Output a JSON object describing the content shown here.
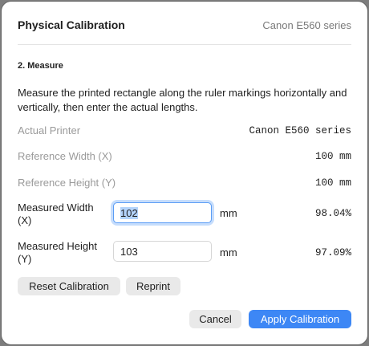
{
  "header": {
    "title": "Physical Calibration",
    "device": "Canon E560 series"
  },
  "section": {
    "title": "2. Measure",
    "instruction": "Measure the printed rectangle along the ruler markings horizontally and vertically, then enter the actual lengths."
  },
  "rows": {
    "printer_label": "Actual Printer",
    "printer_value": "Canon E560 series",
    "ref_width_label": "Reference Width (X)",
    "ref_width_value": "100 mm",
    "ref_height_label": "Reference Height (Y)",
    "ref_height_value": "100 mm",
    "meas_width_label_1": "Measured Width",
    "meas_width_label_2": "(X)",
    "meas_width_input": "102",
    "meas_width_unit": "mm",
    "meas_width_pct": "98.04%",
    "meas_height_label_1": "Measured Height",
    "meas_height_label_2": "(Y)",
    "meas_height_input": "103",
    "meas_height_unit": "mm",
    "meas_height_pct": "97.09%"
  },
  "buttons": {
    "reset": "Reset Calibration",
    "reprint": "Reprint",
    "cancel": "Cancel",
    "apply": "Apply Calibration"
  }
}
